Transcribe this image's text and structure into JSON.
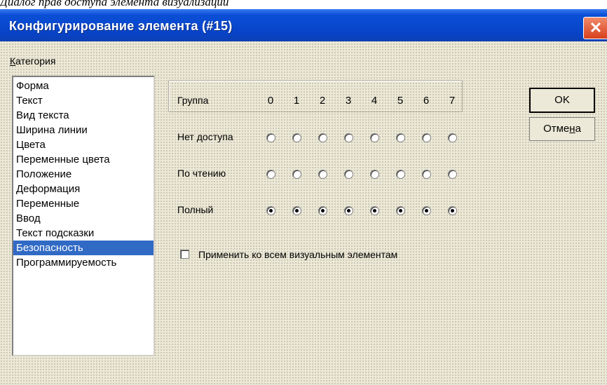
{
  "caption": "Диалог прав доступа элемента визуализации",
  "window": {
    "title": "Конфигурирование элемента (#15)",
    "close_glyph": "✕"
  },
  "category": {
    "label_prefix": "К",
    "label_rest": "атегория",
    "items": [
      {
        "label": "Форма"
      },
      {
        "label": "Текст"
      },
      {
        "label": "Вид текста"
      },
      {
        "label": "Ширина линии"
      },
      {
        "label": "Цвета"
      },
      {
        "label": "Переменные цвета"
      },
      {
        "label": "Положение"
      },
      {
        "label": "Деформация"
      },
      {
        "label": "Переменные"
      },
      {
        "label": "Ввод"
      },
      {
        "label": "Текст подсказки"
      },
      {
        "label": "Безопасность",
        "selected": true
      },
      {
        "label": "Программируемость"
      }
    ]
  },
  "access": {
    "group_label": "Группа",
    "groups": [
      "0",
      "1",
      "2",
      "3",
      "4",
      "5",
      "6",
      "7"
    ],
    "rows": [
      {
        "label": "Нет доступа",
        "selected": [
          false,
          false,
          false,
          false,
          false,
          false,
          false,
          false
        ]
      },
      {
        "label": "По чтению",
        "selected": [
          false,
          false,
          false,
          false,
          false,
          false,
          false,
          false
        ]
      },
      {
        "label": "Полный",
        "selected": [
          true,
          true,
          true,
          true,
          true,
          true,
          true,
          true
        ]
      }
    ]
  },
  "apply_all": {
    "label": "Применить ко всем визуальным элементам",
    "checked": false
  },
  "buttons": {
    "ok": "OK",
    "cancel_prefix": "Отме",
    "cancel_underlined": "н",
    "cancel_suffix": "а"
  },
  "colors": {
    "title_bar": "#0a4fd6",
    "selection": "#316ac5",
    "dialog_bg": "#ece9d8",
    "close_button": "#d8401e"
  }
}
